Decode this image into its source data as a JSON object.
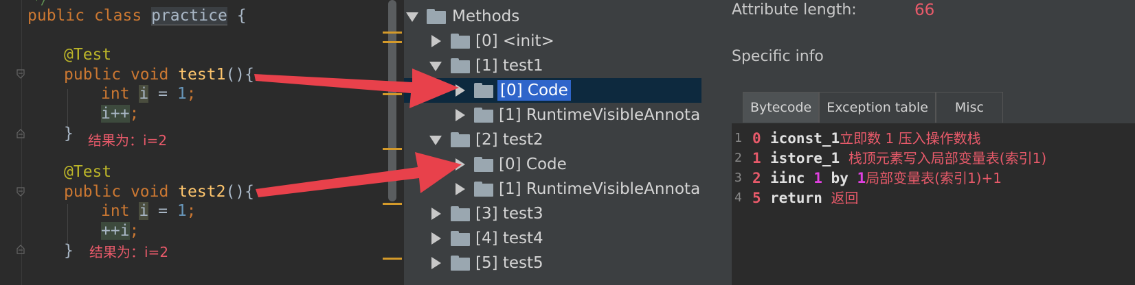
{
  "editor": {
    "top_comment": "*/",
    "class_line": {
      "kw1": "public",
      "kw2": "class",
      "name": "practice",
      "brace": "{"
    },
    "test1": {
      "annotation": "@Test",
      "signature": {
        "kw1": "public",
        "kw2": "void",
        "name": "test1",
        "rest": "(){"
      },
      "line1": {
        "kw": "int",
        "var": "i",
        "op": " = ",
        "num": "1",
        "end": ";"
      },
      "line2": {
        "expr": "i++",
        "end": ";"
      },
      "close": "}",
      "note": "结果为：i=2"
    },
    "test2": {
      "annotation": "@Test",
      "signature": {
        "kw1": "public",
        "kw2": "void",
        "name": "test2",
        "rest": "(){"
      },
      "line1": {
        "kw": "int",
        "var": "i",
        "op": " = ",
        "num": "1",
        "end": ";"
      },
      "line2": {
        "expr": "++i",
        "end": ";"
      },
      "close": "}",
      "note": "结果为：i=2"
    }
  },
  "tree": {
    "rows": [
      {
        "label": "Methods",
        "expanded": true
      },
      {
        "label": "[0] <init>",
        "expanded": false
      },
      {
        "label": "[1] test1",
        "expanded": true
      },
      {
        "label": "[0] Code",
        "expanded": false,
        "selected": true
      },
      {
        "label": "[1] RuntimeVisibleAnnota",
        "expanded": false
      },
      {
        "label": "[2] test2",
        "expanded": true
      },
      {
        "label": "[0] Code",
        "expanded": false
      },
      {
        "label": "[1] RuntimeVisibleAnnota",
        "expanded": false
      },
      {
        "label": "[3] test3",
        "expanded": false
      },
      {
        "label": "[4] test4",
        "expanded": false
      },
      {
        "label": "[5] test5",
        "expanded": false
      }
    ]
  },
  "info": {
    "attribute_length_label": "Attribute length:",
    "attribute_length_value": "66",
    "specific_info": "Specific info",
    "tabs": [
      "Bytecode",
      "Exception table",
      "Misc"
    ],
    "active_tab": "Bytecode",
    "bytecode": [
      {
        "line": "1",
        "offset": "0",
        "op": "iconst_1",
        "args": "",
        "note": "立即数 1 压入操作数栈"
      },
      {
        "line": "2",
        "offset": "1",
        "op": "istore_1",
        "args": "",
        "note": "栈顶元素写入局部变量表(索引1)"
      },
      {
        "line": "3",
        "offset": "2",
        "op": "iinc",
        "arg1": "1",
        "by": "by",
        "arg2": "1",
        "note": "局部变量表(索引1)+1"
      },
      {
        "line": "4",
        "offset": "5",
        "op": "return",
        "args": "",
        "note": "返回"
      }
    ]
  },
  "colors": {
    "annotation_arrow": "#e8414b",
    "note_text": "#e85a6a",
    "selection": "#2f65ca"
  }
}
